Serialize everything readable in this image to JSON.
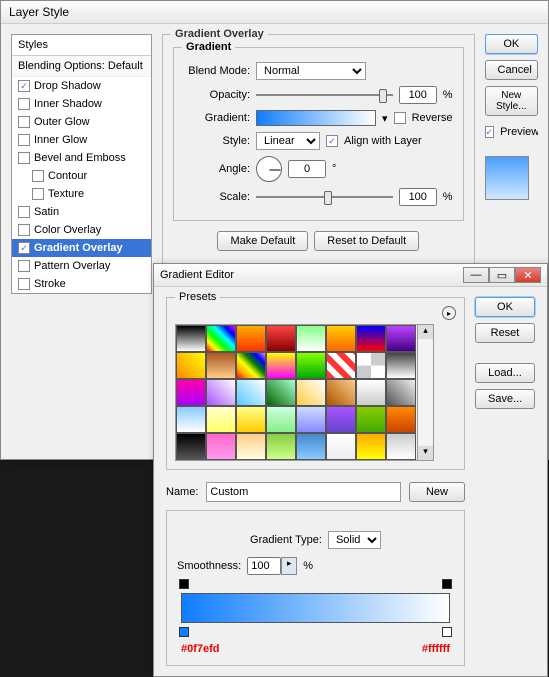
{
  "layerStyle": {
    "title": "Layer Style",
    "stylesHeader": "Styles",
    "blendingHeader": "Blending Options: Default",
    "items": [
      {
        "label": "Drop Shadow",
        "checked": true,
        "indent": false
      },
      {
        "label": "Inner Shadow",
        "checked": false,
        "indent": false
      },
      {
        "label": "Outer Glow",
        "checked": false,
        "indent": false
      },
      {
        "label": "Inner Glow",
        "checked": false,
        "indent": false
      },
      {
        "label": "Bevel and Emboss",
        "checked": false,
        "indent": false
      },
      {
        "label": "Contour",
        "checked": false,
        "indent": true
      },
      {
        "label": "Texture",
        "checked": false,
        "indent": true
      },
      {
        "label": "Satin",
        "checked": false,
        "indent": false
      },
      {
        "label": "Color Overlay",
        "checked": false,
        "indent": false
      },
      {
        "label": "Gradient Overlay",
        "checked": true,
        "indent": false,
        "selected": true
      },
      {
        "label": "Pattern Overlay",
        "checked": false,
        "indent": false
      },
      {
        "label": "Stroke",
        "checked": false,
        "indent": false
      }
    ],
    "groupTitle": "Gradient Overlay",
    "subTitle": "Gradient",
    "blendModeLabel": "Blend Mode:",
    "blendMode": "Normal",
    "opacityLabel": "Opacity:",
    "opacity": "100",
    "pct": "%",
    "gradientLabel": "Gradient:",
    "reverseLabel": "Reverse",
    "styleLabel": "Style:",
    "styleValue": "Linear",
    "alignLabel": "Align with Layer",
    "angleLabel": "Angle:",
    "angle": "0",
    "deg": "°",
    "scaleLabel": "Scale:",
    "scale": "100",
    "makeDefault": "Make Default",
    "resetDefault": "Reset to Default",
    "ok": "OK",
    "cancel": "Cancel",
    "newStyle": "New Style...",
    "previewLabel": "Preview"
  },
  "gradientEditor": {
    "title": "Gradient Editor",
    "presetsLabel": "Presets",
    "ok": "OK",
    "reset": "Reset",
    "load": "Load...",
    "save": "Save...",
    "nameLabel": "Name:",
    "nameValue": "Custom",
    "new": "New",
    "gradTypeLabel": "Gradient Type:",
    "gradType": "Solid",
    "smoothLabel": "Smoothness:",
    "smooth": "100",
    "pct": "%",
    "leftColor": "#0f7efd",
    "rightColor": "#ffffff"
  }
}
